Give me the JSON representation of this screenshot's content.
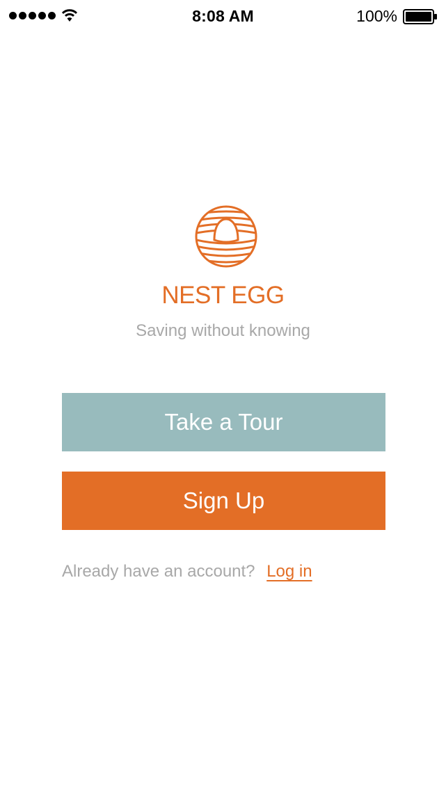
{
  "status_bar": {
    "time": "8:08 AM",
    "battery_percent": "100%",
    "signal_icon": "signal-dots-icon",
    "wifi_icon": "wifi-icon",
    "battery_icon": "battery-full-icon"
  },
  "brand": {
    "logo_icon": "nest-egg-logo-icon",
    "title": "NEST EGG",
    "tagline": "Saving without knowing"
  },
  "actions": {
    "tour_label": "Take a Tour",
    "signup_label": "Sign Up"
  },
  "account": {
    "prompt": "Already have an account?",
    "login_label": "Log in"
  },
  "colors": {
    "accent": "#e36e26",
    "secondary": "#98bbbd",
    "muted_text": "#a8a8a8",
    "background": "#ffffff"
  }
}
